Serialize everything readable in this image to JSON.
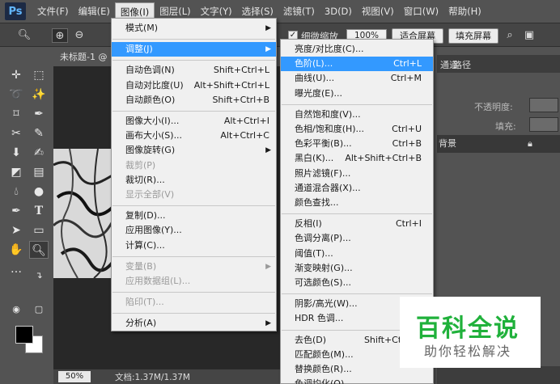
{
  "app": {
    "logo": "Ps"
  },
  "menubar": {
    "items": [
      "文件(F)",
      "编辑(E)",
      "图像(I)",
      "图层(L)",
      "文字(Y)",
      "选择(S)",
      "滤镜(T)",
      "3D(D)",
      "视图(V)",
      "窗口(W)",
      "帮助(H)"
    ],
    "active": "图像(I)"
  },
  "options_bar": {
    "checkbox_label": "细微缩放",
    "zoom_value": "100%",
    "fit_screen_button": "适合屏幕",
    "fill_screen_button": "填充屏幕"
  },
  "document": {
    "tab_title": "未标题-1 @",
    "zoom": "50%",
    "info": "文档:1.37M/1.37M"
  },
  "image_menu": [
    {
      "label": "模式(M)",
      "submenu": true
    },
    {
      "separator": true
    },
    {
      "label": "调整(J)",
      "submenu": true,
      "highlighted": true
    },
    {
      "separator": true
    },
    {
      "label": "自动色调(N)",
      "shortcut": "Shift+Ctrl+L"
    },
    {
      "label": "自动对比度(U)",
      "shortcut": "Alt+Shift+Ctrl+L"
    },
    {
      "label": "自动颜色(O)",
      "shortcut": "Shift+Ctrl+B"
    },
    {
      "separator": true
    },
    {
      "label": "图像大小(I)...",
      "shortcut": "Alt+Ctrl+I"
    },
    {
      "label": "画布大小(S)...",
      "shortcut": "Alt+Ctrl+C"
    },
    {
      "label": "图像旋转(G)",
      "submenu": true
    },
    {
      "label": "裁剪(P)",
      "disabled": true
    },
    {
      "label": "裁切(R)..."
    },
    {
      "label": "显示全部(V)",
      "disabled": true
    },
    {
      "separator": true
    },
    {
      "label": "复制(D)..."
    },
    {
      "label": "应用图像(Y)..."
    },
    {
      "label": "计算(C)..."
    },
    {
      "separator": true
    },
    {
      "label": "变量(B)",
      "submenu": true,
      "disabled": true
    },
    {
      "label": "应用数据组(L)...",
      "disabled": true
    },
    {
      "separator": true
    },
    {
      "label": "陷印(T)...",
      "disabled": true
    },
    {
      "separator": true
    },
    {
      "label": "分析(A)",
      "submenu": true
    }
  ],
  "adjust_menu": [
    {
      "label": "亮度/对比度(C)..."
    },
    {
      "label": "色阶(L)...",
      "shortcut": "Ctrl+L",
      "highlighted": true
    },
    {
      "label": "曲线(U)...",
      "shortcut": "Ctrl+M"
    },
    {
      "label": "曝光度(E)..."
    },
    {
      "separator": true
    },
    {
      "label": "自然饱和度(V)..."
    },
    {
      "label": "色相/饱和度(H)...",
      "shortcut": "Ctrl+U"
    },
    {
      "label": "色彩平衡(B)...",
      "shortcut": "Ctrl+B"
    },
    {
      "label": "黑白(K)...",
      "shortcut": "Alt+Shift+Ctrl+B"
    },
    {
      "label": "照片滤镜(F)..."
    },
    {
      "label": "通道混合器(X)..."
    },
    {
      "label": "颜色查找..."
    },
    {
      "separator": true
    },
    {
      "label": "反相(I)",
      "shortcut": "Ctrl+I"
    },
    {
      "label": "色调分离(P)..."
    },
    {
      "label": "阈值(T)..."
    },
    {
      "label": "渐变映射(G)..."
    },
    {
      "label": "可选颜色(S)..."
    },
    {
      "separator": true
    },
    {
      "label": "阴影/高光(W)..."
    },
    {
      "label": "HDR 色调..."
    },
    {
      "separator": true
    },
    {
      "label": "去色(D)",
      "shortcut": "Shift+Ctrl+U"
    },
    {
      "label": "匹配颜色(M)..."
    },
    {
      "label": "替换颜色(R)..."
    },
    {
      "label": "色调均化(Q)"
    }
  ],
  "panel": {
    "tabs": [
      "通道",
      "路径"
    ],
    "opacity_label": "不透明度:",
    "fill_label": "填充:",
    "layer_name": "背景"
  },
  "watermark": {
    "title": "百科全说",
    "subtitle": "助你轻松解决"
  },
  "colors": {
    "ui_bg": "#535353",
    "menu_bg": "#f0f0f0",
    "highlight": "#3399ff",
    "watermark_green": "#20b13b"
  }
}
